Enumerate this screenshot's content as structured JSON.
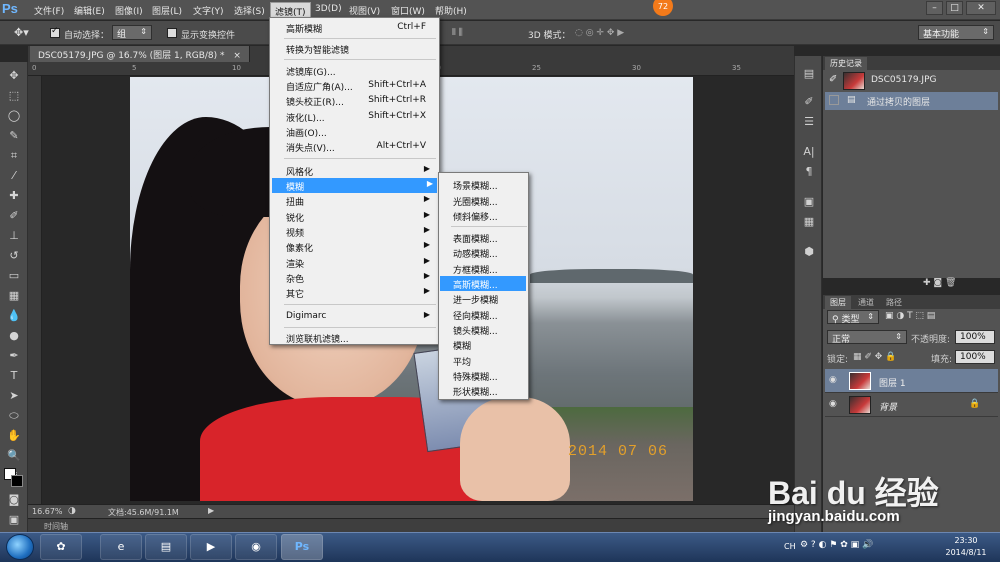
{
  "app": {
    "logo": "Ps",
    "badge": "72"
  },
  "menubar": {
    "items": [
      "文件(F)",
      "编辑(E)",
      "图像(I)",
      "图层(L)",
      "文字(Y)",
      "选择(S)",
      "滤镜(T)",
      "3D(D)",
      "视图(V)",
      "窗口(W)",
      "帮助(H)"
    ],
    "active_index": 6
  },
  "options": {
    "auto_select_label": "自动选择：",
    "auto_select_value": "组",
    "show_transform_label": "显示变换控件",
    "mode3d_label": "3D 模式：",
    "workspace": "基本功能"
  },
  "document": {
    "tab_title": "DSC05179.JPG @ 16.7% (图层 1, RGB/8) *",
    "zoom": "16.67%",
    "doc_size": "文档:45.6M/91.1M",
    "timeline_label": "时间轴",
    "date_stamp": "2014 07 06",
    "ruler_ticks": [
      "0",
      "5",
      "10",
      "15",
      "20",
      "25",
      "30",
      "35"
    ]
  },
  "filter_menu": {
    "items": [
      {
        "label": "高斯模糊",
        "shortcut": "Ctrl+F"
      },
      {
        "label": "转换为智能滤镜",
        "shortcut": ""
      },
      {
        "label": "滤镜库(G)...",
        "shortcut": ""
      },
      {
        "label": "自适应广角(A)...",
        "shortcut": "Shift+Ctrl+A"
      },
      {
        "label": "镜头校正(R)...",
        "shortcut": "Shift+Ctrl+R"
      },
      {
        "label": "液化(L)...",
        "shortcut": "Shift+Ctrl+X"
      },
      {
        "label": "油画(O)...",
        "shortcut": ""
      },
      {
        "label": "消失点(V)...",
        "shortcut": "Alt+Ctrl+V"
      },
      {
        "label": "风格化",
        "shortcut": ""
      },
      {
        "label": "模糊",
        "shortcut": ""
      },
      {
        "label": "扭曲",
        "shortcut": ""
      },
      {
        "label": "锐化",
        "shortcut": ""
      },
      {
        "label": "视频",
        "shortcut": ""
      },
      {
        "label": "像素化",
        "shortcut": ""
      },
      {
        "label": "渲染",
        "shortcut": ""
      },
      {
        "label": "杂色",
        "shortcut": ""
      },
      {
        "label": "其它",
        "shortcut": ""
      },
      {
        "label": "Digimarc",
        "shortcut": ""
      },
      {
        "label": "浏览联机滤镜...",
        "shortcut": ""
      }
    ],
    "highlighted_index": 9
  },
  "blur_submenu": {
    "items": [
      "场景模糊...",
      "光圈模糊...",
      "倾斜偏移...",
      "表面模糊...",
      "动感模糊...",
      "方框模糊...",
      "高斯模糊...",
      "进一步模糊",
      "径向模糊...",
      "镜头模糊...",
      "模糊",
      "平均",
      "特殊模糊...",
      "形状模糊..."
    ],
    "highlighted_index": 6
  },
  "history_panel": {
    "tab": "历史记录",
    "snapshot": "DSC05179.JPG",
    "states": [
      "通过拷贝的图层"
    ]
  },
  "layers_panel": {
    "tabs": [
      "图层",
      "通道",
      "路径"
    ],
    "filter_kind": "类型",
    "blend_mode": "正常",
    "opacity_label": "不透明度:",
    "opacity_value": "100%",
    "lock_label": "锁定:",
    "fill_label": "填充:",
    "fill_value": "100%",
    "layers": [
      {
        "name": "图层 1",
        "selected": true
      },
      {
        "name": "背景",
        "selected": false
      }
    ]
  },
  "taskbar": {
    "language": "CH",
    "time": "23:30",
    "date": "2014/8/11"
  },
  "watermark": {
    "brand": "Bai du 经验",
    "url": "jingyan.baidu.com"
  }
}
